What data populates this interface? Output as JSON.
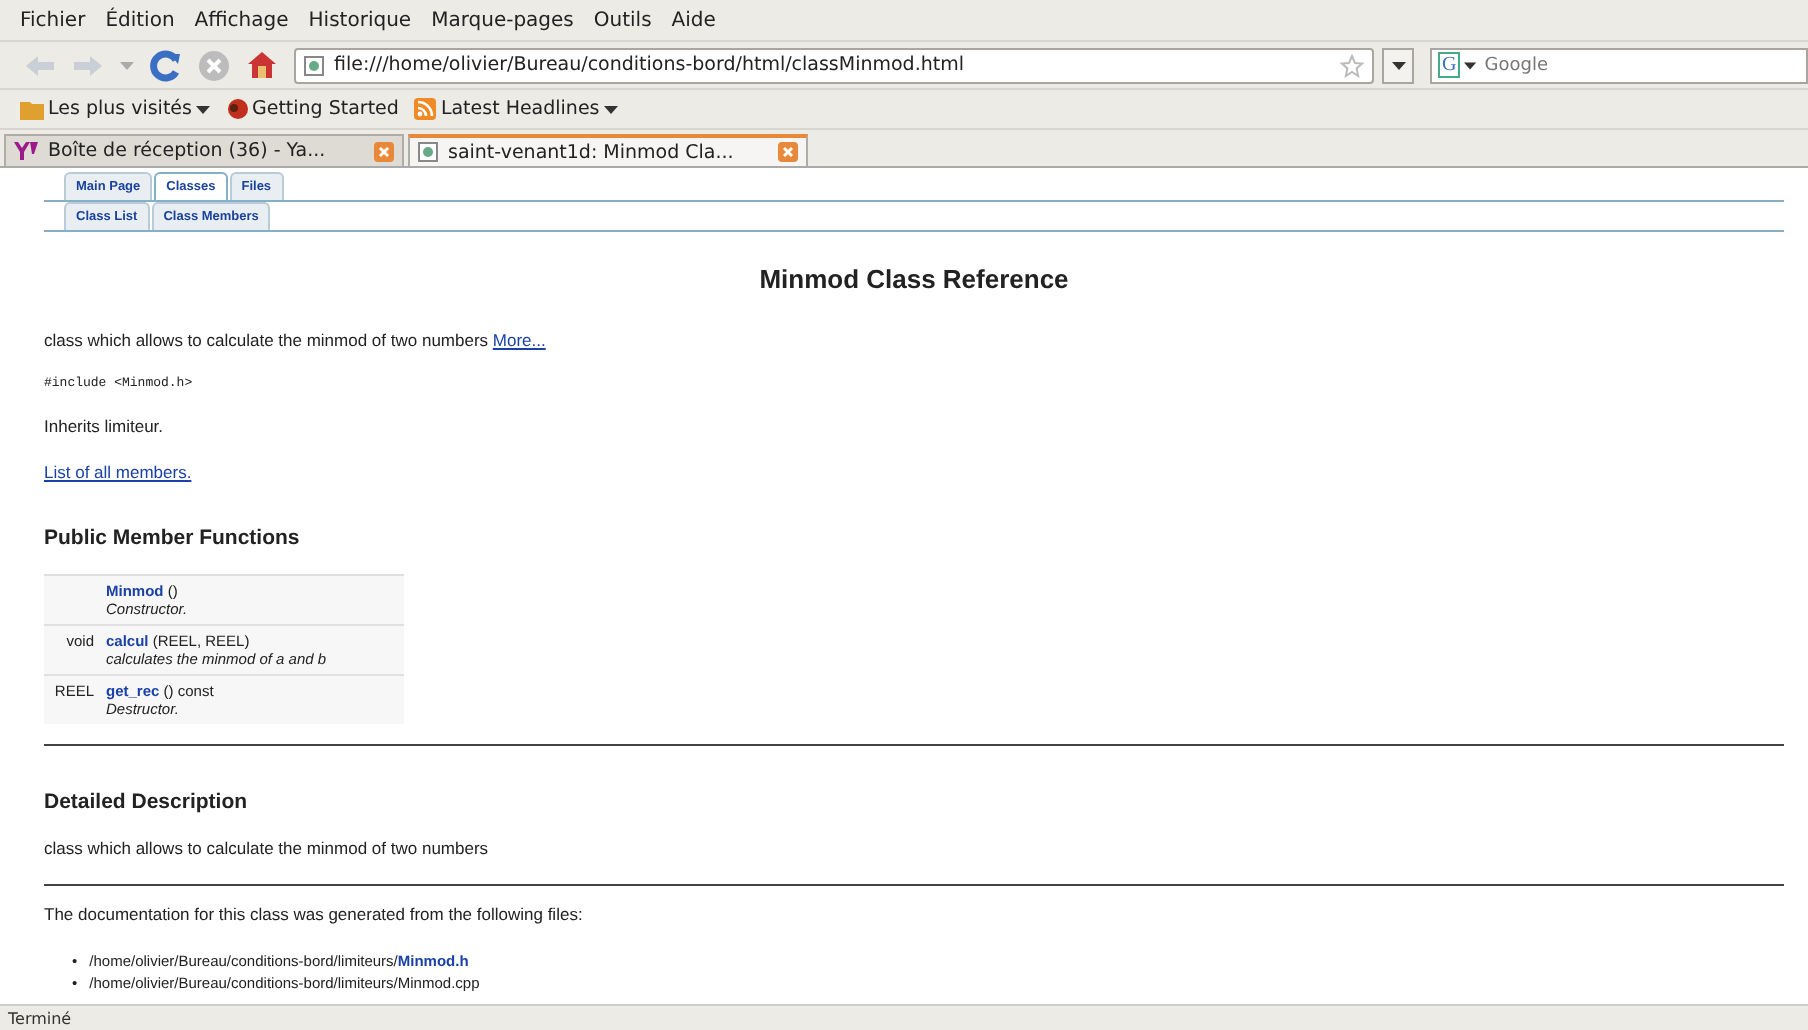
{
  "menu": [
    "Fichier",
    "Édition",
    "Affichage",
    "Historique",
    "Marque-pages",
    "Outils",
    "Aide"
  ],
  "address": {
    "value": "file:///home/olivier/Bureau/conditions-bord/html/classMinmod.html"
  },
  "search": {
    "engine": "G",
    "placeholder": "Google"
  },
  "bookmarks": [
    {
      "label": "Les plus visités",
      "kind": "folder",
      "dropdown": true
    },
    {
      "label": "Getting Started",
      "kind": "page",
      "dropdown": false
    },
    {
      "label": "Latest Headlines",
      "kind": "feed",
      "dropdown": true
    }
  ],
  "browser_tabs": [
    {
      "label": "Boîte de réception (36) - Ya...",
      "kind": "mail",
      "selected": false
    },
    {
      "label": "saint-venant1d: Minmod Cla...",
      "kind": "page",
      "selected": true
    }
  ],
  "doc_tabs": [
    {
      "label": "Main Page",
      "selected": false
    },
    {
      "label": "Classes",
      "selected": true
    },
    {
      "label": "Files",
      "selected": false
    }
  ],
  "doc_subtabs": [
    {
      "label": "Class List",
      "selected": false
    },
    {
      "label": "Class Members",
      "selected": false
    }
  ],
  "title": "Minmod Class Reference",
  "brief": {
    "text": "class which allows to calculate the minmod of two numbers",
    "link": "More..."
  },
  "include": "#include <Minmod.h>",
  "inherits": "Inherits limiteur.",
  "all_members": "List of all members.",
  "public_heading": "Public Member Functions",
  "members": [
    {
      "name": "Minmod",
      "args": "()",
      "desc": "Constructor."
    },
    {
      "type": "void",
      "name": "calcul",
      "args": "(REEL, REEL)",
      "desc": "calculates the minmod of a and b"
    },
    {
      "type": "REEL",
      "name": "get_rec",
      "args": "() const",
      "desc": "Destructor."
    }
  ],
  "detail_heading": "Detailed Description",
  "detail": "class which allows to calculate the minmod of two numbers",
  "generated": "The documentation for this class was generated from the following files:",
  "files": [
    {
      "bullet": "•",
      "path": "/home/olivier/Bureau/conditions-bord/limiteurs/",
      "name": "Minmod.h",
      "linked": true
    },
    {
      "bullet": "•",
      "path": "/home/olivier/Bureau/conditions-bord/limiteurs/",
      "name": "Minmod.cpp",
      "linked": false
    }
  ],
  "status": "Terminé"
}
